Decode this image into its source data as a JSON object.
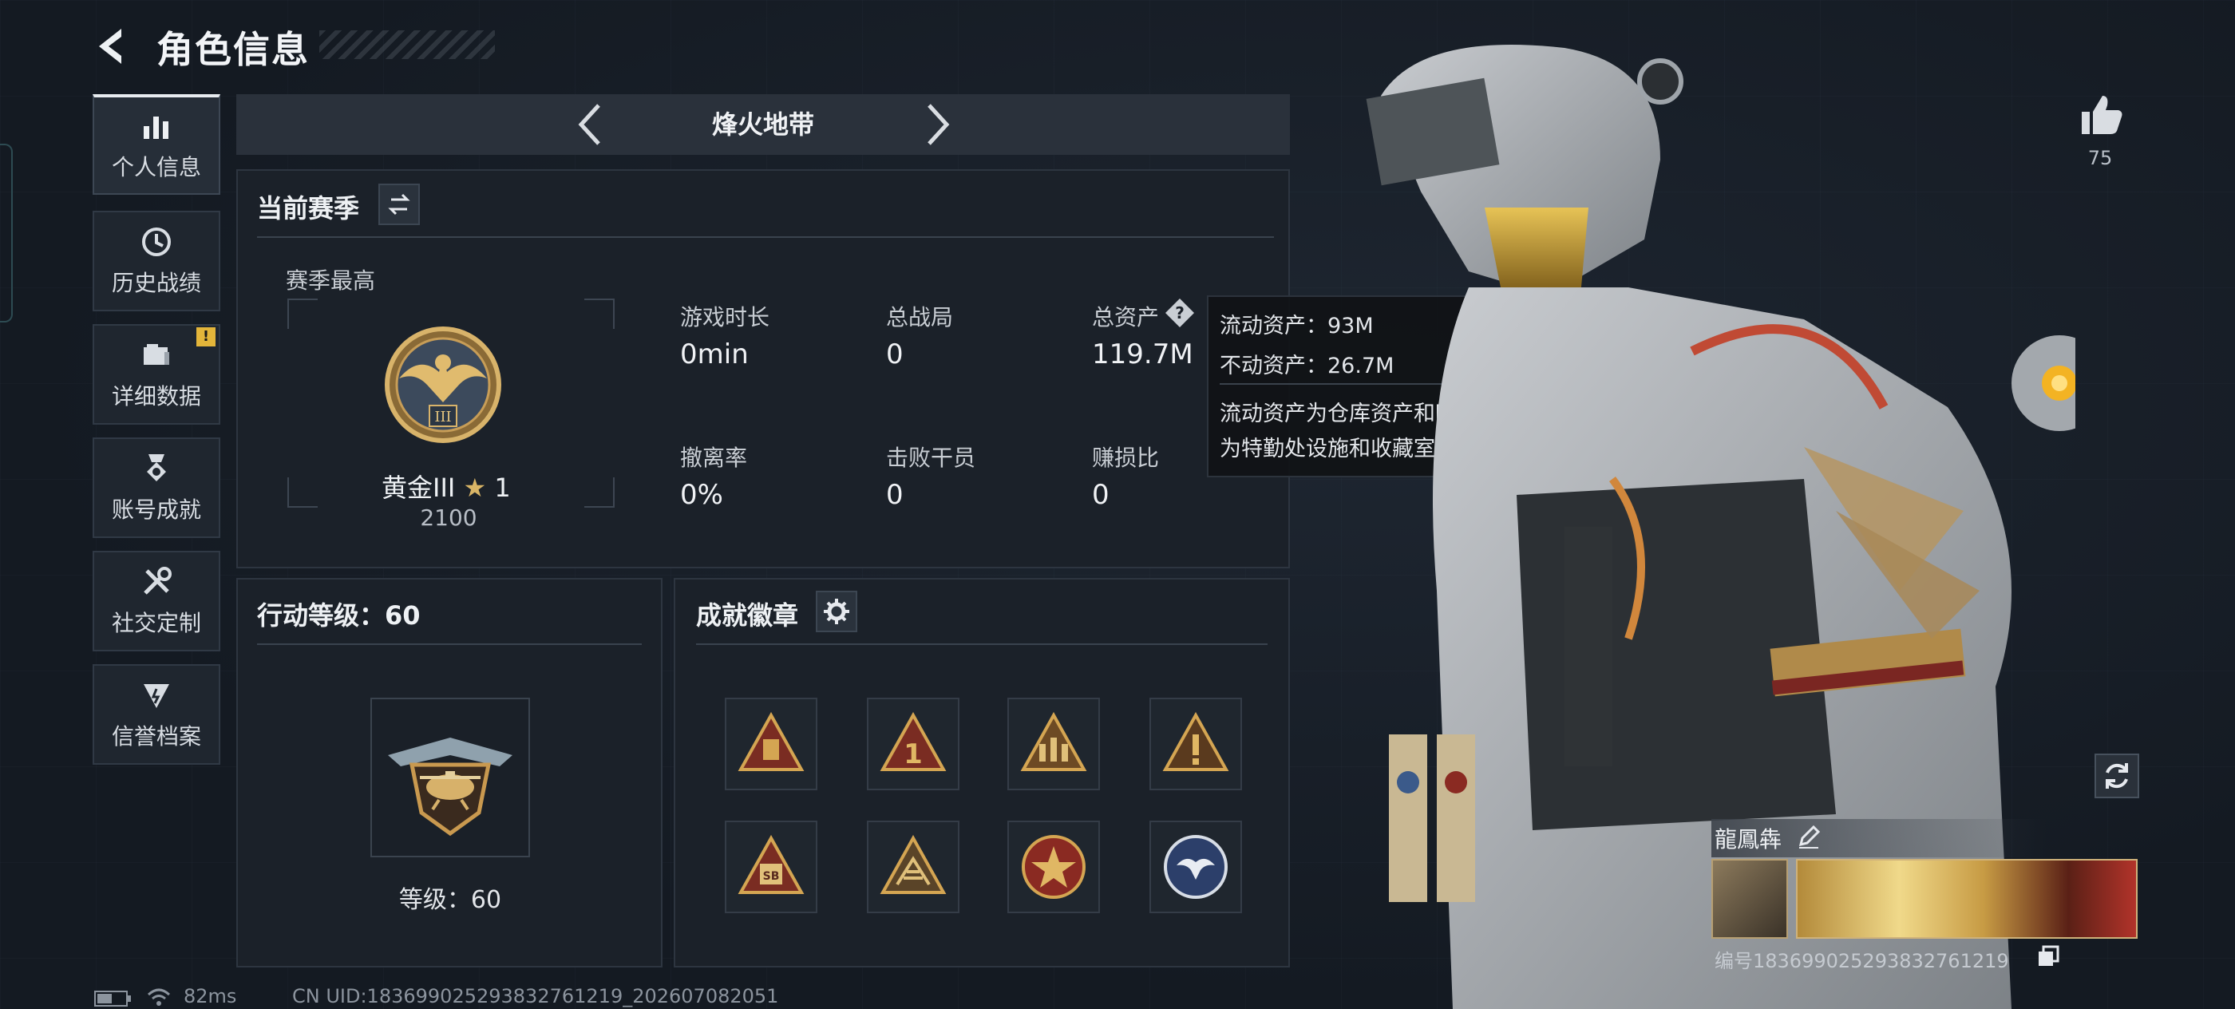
{
  "header": {
    "title": "角色信息"
  },
  "sidebar": {
    "items": [
      {
        "label": "个人信息",
        "active": true
      },
      {
        "label": "历史战绩"
      },
      {
        "label": "详细数据",
        "badge": "!"
      },
      {
        "label": "账号成就"
      },
      {
        "label": "社交定制"
      },
      {
        "label": "信誉档案"
      }
    ]
  },
  "mode": {
    "title": "烽火地带"
  },
  "season": {
    "title": "当前赛季",
    "best_label": "赛季最高",
    "rank_name": "黄金III",
    "rank_stars": "1",
    "rank_score": "2100",
    "rank_roman": "III",
    "stats": [
      {
        "label": "游戏时长",
        "value": "0min"
      },
      {
        "label": "总战局",
        "value": "0"
      },
      {
        "label": "总资产",
        "value": "119.7M"
      },
      {
        "label": "撤离率",
        "value": "0%"
      },
      {
        "label": "击败干员",
        "value": "0"
      },
      {
        "label": "赚损比",
        "value": "0"
      }
    ]
  },
  "tooltip": {
    "line1": "流动资产：93M",
    "line2": "不动资产：26.7M",
    "line3": "流动资产为仓库资产和哈夫币，不动资产",
    "line4": "为特勤处设施和收藏室设施"
  },
  "action_level": {
    "title": "行动等级：60",
    "level_label": "等级：60"
  },
  "achievements": {
    "title": "成就徽章",
    "badges": [
      "cargo",
      "number-one",
      "squad",
      "warning",
      "sb-crate",
      "stack",
      "star-seal",
      "eagle-seal"
    ]
  },
  "profile": {
    "likes": "75",
    "name": "龍鳳犇",
    "id_text": "编号183699025293832761219"
  },
  "status": {
    "ping": "82ms",
    "uid": "CN UID:183699025293832761219_202607082051"
  },
  "colors": {
    "accent": "#e3b53a",
    "gold": "#b88a3e",
    "panel": "#1b2129"
  }
}
